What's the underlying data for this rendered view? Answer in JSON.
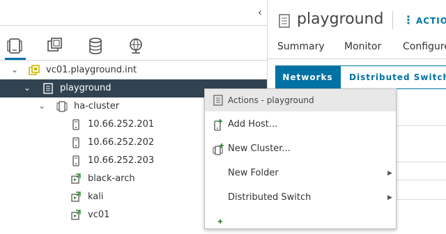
{
  "left": {
    "collapse_icon": "chevron-left-icon",
    "nav_icons": [
      "hosts-and-clusters-icon",
      "vms-and-templates-icon",
      "storage-icon",
      "networking-icon"
    ],
    "tree": [
      {
        "label": "vc01.playground.int",
        "icon": "vcenter-icon",
        "expanded": true
      },
      {
        "label": "playground",
        "icon": "datacenter-icon",
        "expanded": true,
        "selected": true
      },
      {
        "label": "ha-cluster",
        "icon": "cluster-icon",
        "expanded": true
      },
      {
        "label": "10.66.252.201",
        "icon": "host-icon"
      },
      {
        "label": "10.66.252.202",
        "icon": "host-icon"
      },
      {
        "label": "10.66.252.203",
        "icon": "host-icon"
      },
      {
        "label": "black-arch",
        "icon": "vm-icon"
      },
      {
        "label": "kali",
        "icon": "vm-icon"
      },
      {
        "label": "vc01",
        "icon": "vm-icon"
      }
    ]
  },
  "right": {
    "title": "playground",
    "actions_label": "ACTION",
    "tabs": [
      "Summary",
      "Monitor",
      "Configure"
    ],
    "subtabs": [
      "Networks",
      "Distributed Switche"
    ],
    "accent": "#0072a3"
  },
  "context_menu": {
    "header": "Actions - playground",
    "items": [
      {
        "label": "Add Host...",
        "icon": "add-host-icon"
      },
      {
        "label": "New Cluster...",
        "icon": "new-cluster-icon"
      },
      {
        "label": "New Folder",
        "submenu": true
      },
      {
        "label": "Distributed Switch",
        "submenu": true
      }
    ]
  },
  "colors": {
    "selected_row": "#314351",
    "vm_green": "#2e8b32",
    "vcenter_yellow": "#c8b400"
  }
}
